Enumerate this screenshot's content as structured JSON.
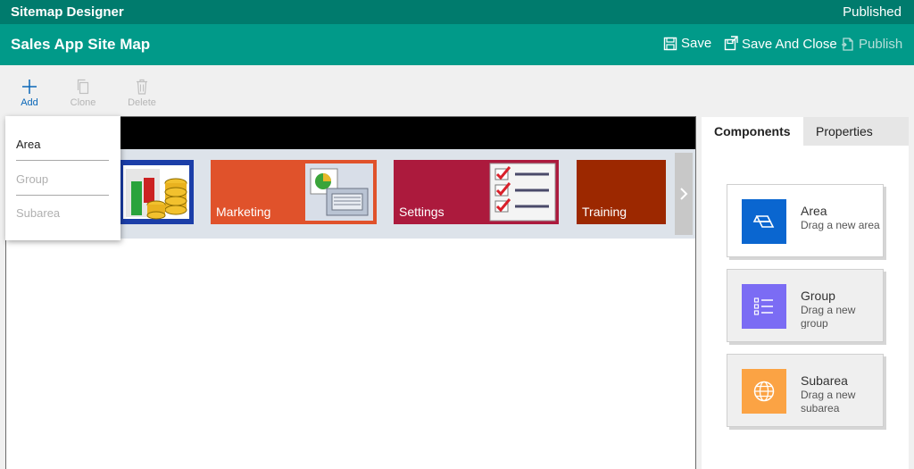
{
  "topbar": {
    "app_title": "Sitemap Designer",
    "status": "Published"
  },
  "header": {
    "title": "Sales App Site Map",
    "buttons": {
      "save": "Save",
      "save_and_close": "Save And Close",
      "publish": "Publish"
    }
  },
  "toolbar": {
    "add": "Add",
    "clone": "Clone",
    "delete": "Delete"
  },
  "add_menu": {
    "items": [
      {
        "label": "Area"
      },
      {
        "label": "Group"
      },
      {
        "label": "Subarea"
      }
    ]
  },
  "areas": [
    {
      "label": "",
      "color": "#1b3ea8",
      "icon": "database-icon"
    },
    {
      "label": "Marketing",
      "color": "#e0522b",
      "icon": "marketing-icon"
    },
    {
      "label": "Settings",
      "color": "#ac1a3d",
      "icon": "checklist-icon"
    },
    {
      "label": "Training",
      "color": "#9c2800",
      "icon": ""
    }
  ],
  "right_panel": {
    "tabs": [
      {
        "label": "Components",
        "active": true
      },
      {
        "label": "Properties",
        "active": false
      }
    ],
    "components": [
      {
        "title": "Area",
        "desc": "Drag a new area",
        "color": "#0a66d0",
        "icon": "area-icon"
      },
      {
        "title": "Group",
        "desc": "Drag a new group",
        "color": "#7b6cf4",
        "icon": "group-list-icon"
      },
      {
        "title": "Subarea",
        "desc": "Drag a new subarea",
        "color": "#fba344",
        "icon": "globe-icon"
      }
    ]
  }
}
